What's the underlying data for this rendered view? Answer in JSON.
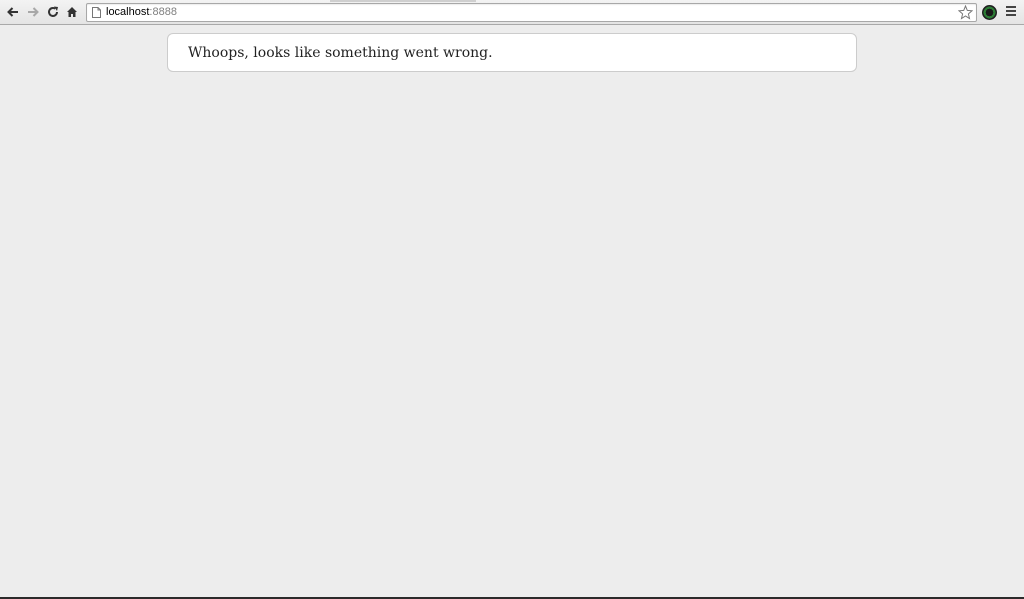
{
  "browser": {
    "address_bar": {
      "host": "localhost",
      "port": ":8888"
    },
    "icons": {
      "back": "arrow-left-icon",
      "forward": "arrow-right-icon",
      "reload": "reload-icon",
      "home": "home-icon",
      "page": "page-icon",
      "bookmark": "star-icon",
      "extension": "extension-icon",
      "menu": "menu-icon"
    }
  },
  "page": {
    "error_message": "Whoops, looks like something went wrong."
  }
}
